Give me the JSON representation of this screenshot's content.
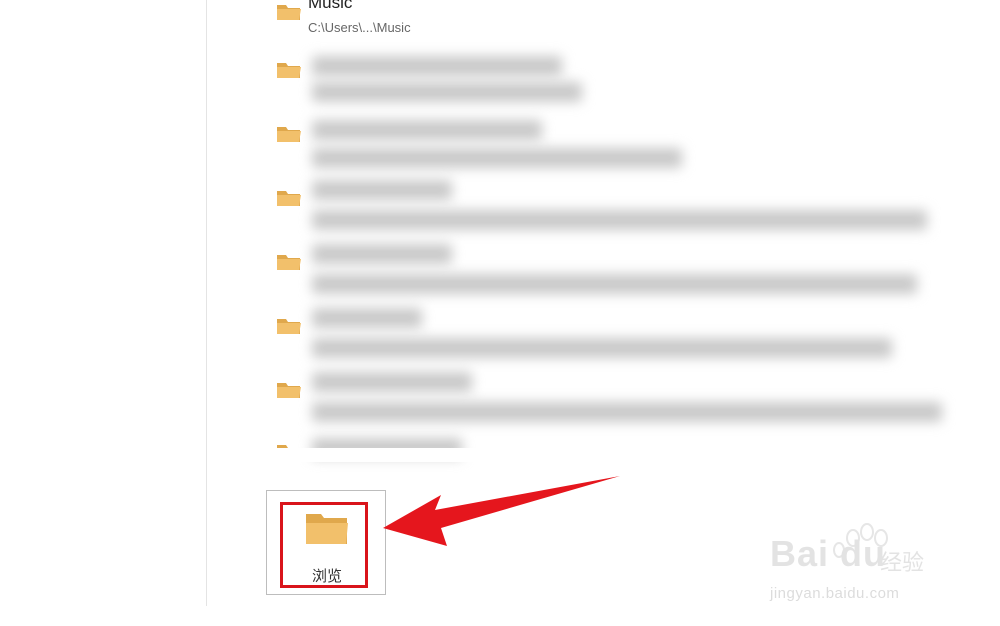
{
  "list": {
    "items": [
      {
        "title": "Music",
        "subtitle": "C:\\Users\\...\\Music",
        "blurred": false
      },
      {
        "title": "",
        "subtitle": "",
        "blurred": true
      },
      {
        "title": "",
        "subtitle": "",
        "blurred": true
      },
      {
        "title": "",
        "subtitle": "",
        "blurred": true
      },
      {
        "title": "",
        "subtitle": "",
        "blurred": true
      },
      {
        "title": "",
        "subtitle": "",
        "blurred": true
      },
      {
        "title": "",
        "subtitle": "",
        "blurred": true
      },
      {
        "title": "",
        "subtitle": "",
        "blurred": true
      }
    ]
  },
  "browse": {
    "label": "浏览",
    "icon": "folder-icon"
  },
  "annotation": {
    "color": "#d9141b",
    "icon": "arrow-icon"
  },
  "watermark": {
    "brand": "Bai du",
    "cn": "经验",
    "url": "jingyan.baidu.com"
  },
  "colors": {
    "folder": "#f2c06b",
    "folder_dark": "#e0a84c",
    "accent": "#d9141b"
  }
}
